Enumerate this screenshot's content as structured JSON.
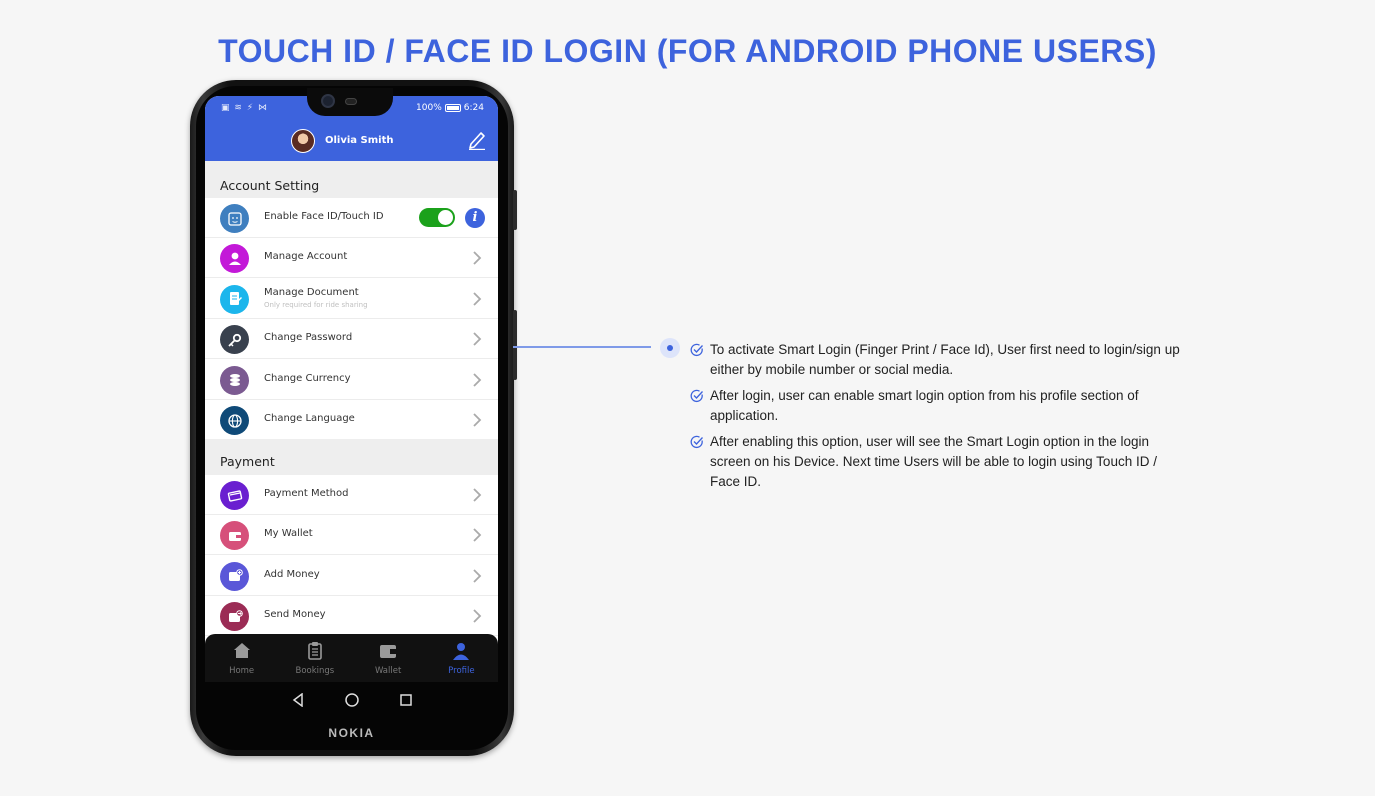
{
  "page": {
    "title": "TOUCH ID / FACE ID LOGIN (FOR ANDROID PHONE USERS)"
  },
  "status_bar": {
    "left_icons": "▣ ≋ ⚡ ⋈",
    "battery_text": "100%",
    "time": "6:24"
  },
  "header": {
    "user_name": "Olivia Smith"
  },
  "account_section": {
    "title": "Account Setting",
    "items": [
      {
        "label": "Enable Face ID/Touch ID",
        "icon": "face-id-icon",
        "color": "#3f7fbf",
        "toggle_on": true
      },
      {
        "label": "Manage Account",
        "icon": "user-icon",
        "color": "#c319d8"
      },
      {
        "label": "Manage Document",
        "sublabel": "Only required for ride sharing",
        "icon": "document-icon",
        "color": "#1cb6ec"
      },
      {
        "label": "Change Password",
        "icon": "key-icon",
        "color": "#39414e"
      },
      {
        "label": "Change Currency",
        "icon": "coins-icon",
        "color": "#7b5a91"
      },
      {
        "label": "Change Language",
        "icon": "globe-icon",
        "color": "#0f4a78"
      }
    ]
  },
  "payment_section": {
    "title": "Payment",
    "items": [
      {
        "label": "Payment Method",
        "icon": "card-icon",
        "color": "#6a1fd0"
      },
      {
        "label": "My Wallet",
        "icon": "wallet-icon",
        "color": "#d6507a"
      },
      {
        "label": "Add Money",
        "icon": "add-money-icon",
        "color": "#5a57d8"
      },
      {
        "label": "Send Money",
        "icon": "send-money-icon",
        "color": "#9b2c55"
      }
    ]
  },
  "tabs": [
    {
      "label": "Home",
      "icon": "home-icon",
      "active": false
    },
    {
      "label": "Bookings",
      "icon": "clipboard-icon",
      "active": false
    },
    {
      "label": "Wallet",
      "icon": "wallet-tab-icon",
      "active": false
    },
    {
      "label": "Profile",
      "icon": "profile-icon",
      "active": true
    }
  ],
  "phone": {
    "brand": "NOKIA"
  },
  "notes": [
    "To activate Smart Login (Finger Print / Face Id), User first need to login/sign up either by mobile number or social media.",
    "After login, user can enable smart login option from his profile section of application.",
    "After enabling this option, user will see the Smart Login option in the login screen on his Device. Next time Users will be able to login using Touch ID / Face ID."
  ],
  "colors": {
    "accent": "#3d63dd",
    "toggle_on": "#1ba11b"
  }
}
